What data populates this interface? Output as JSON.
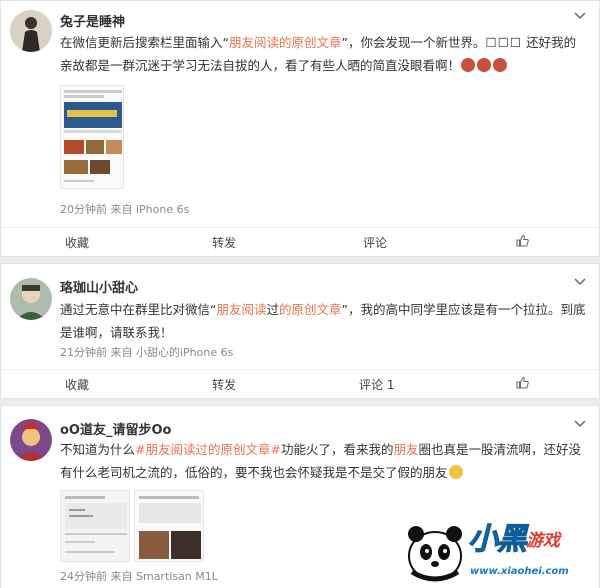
{
  "posts": [
    {
      "username": "兔子是睡神",
      "text_parts": [
        "在微信更新后搜索栏里面输入“",
        "朋友阅读的原创文章",
        "”，你会发现一个新世界。",
        "☐☐☐",
        " 还好我的亲故都是一群沉迷于学习无法自拔的人，看了有些人晒的简直没眼看啊！"
      ],
      "meta": "20分钟前 来自 iPhone 6s",
      "actions": {
        "collect": "收藏",
        "repost": "转发",
        "comment": "评论",
        "like_icon": "thumbs-up-icon"
      }
    },
    {
      "username": "珞珈山小甜心",
      "text_parts": [
        "通过无意中在群里比对微信“",
        "朋友阅读",
        "过",
        "的原创文章",
        "”，我的高中同学里应该是有一个拉拉。到底是谁啊，请联系我！"
      ],
      "meta": "21分钟前 来自 小甜心的iPhone 6s",
      "actions": {
        "collect": "收藏",
        "repost": "转发",
        "comment": "评论 1",
        "like_icon": "thumbs-up-icon"
      }
    },
    {
      "username": "oO道友_请留步Oo",
      "text_parts": [
        "不知道为什么",
        "#朋友阅读过的原创文章#",
        "功能火了，看来我的",
        "朋友",
        "圈也真是一股清流啊，还好没有什么老司机之流的，低俗的，要不我也会怀疑我是不是交了假的朋友"
      ],
      "meta": "24分钟前 来自 Smartisan M1L"
    }
  ],
  "watermark": {
    "title": "小黑",
    "sub": "游戏",
    "url": "www.xiaohei.com"
  },
  "colors": {
    "highlight": "#eb7350",
    "meta": "#888888",
    "brand_blue": "#1a86d6"
  }
}
